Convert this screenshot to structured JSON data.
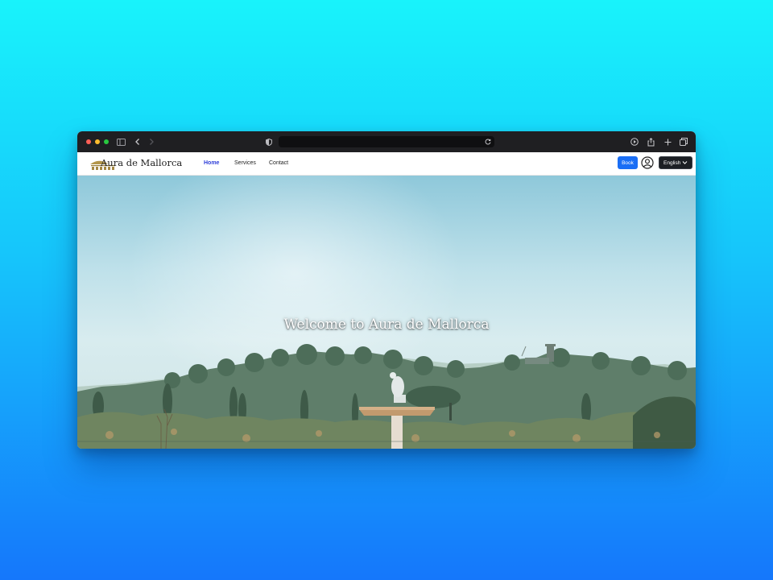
{
  "browser": {
    "traffic_lights": {
      "close": "#ff5f57",
      "minimize": "#febc2e",
      "zoom": "#28c840"
    },
    "icons": [
      "sidebar-icon",
      "back-icon",
      "forward-icon",
      "privacy-shield-icon",
      "reload-icon",
      "downloads-icon",
      "share-icon",
      "new-tab-icon",
      "tab-overview-icon"
    ]
  },
  "site": {
    "brand": "Aura de Mallorca",
    "nav": [
      {
        "label": "Home",
        "active": true
      },
      {
        "label": "Services",
        "active": false
      },
      {
        "label": "Contact",
        "active": false
      }
    ],
    "book_label": "Book",
    "language": "English",
    "accent_color": "#1a6ef5",
    "active_link_color": "#2f3fd9"
  },
  "hero": {
    "title": "Welcome to Aura de Mallorca"
  }
}
